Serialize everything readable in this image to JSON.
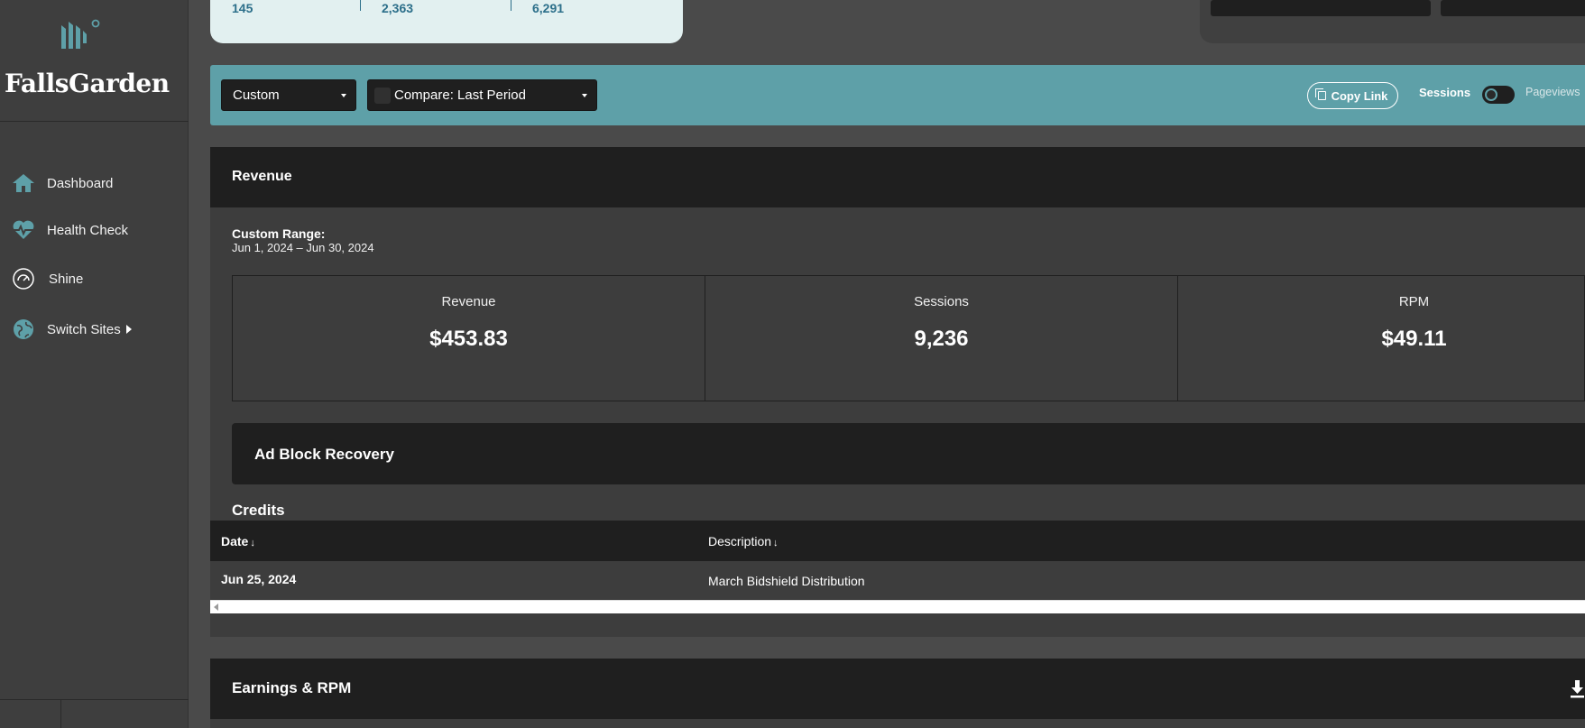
{
  "brand": {
    "name": "FallsGarden"
  },
  "sidebar": {
    "items": [
      {
        "label": "Dashboard",
        "icon": "home-icon"
      },
      {
        "label": "Health Check",
        "icon": "heartbeat-icon"
      },
      {
        "label": "Shine",
        "icon": "gauge-icon"
      },
      {
        "label": "Switch Sites",
        "icon": "globe-icon"
      }
    ]
  },
  "top_stats": {
    "values": [
      "145",
      "2,363",
      "6,291"
    ]
  },
  "filters": {
    "range_select": "Custom",
    "compare_select": "Compare: Last Period",
    "copy_link": "Copy Link",
    "toggle_left": "Sessions",
    "toggle_right": "Pageviews"
  },
  "revenue": {
    "title": "Revenue",
    "range_label": "Custom Range:",
    "range_value": "Jun 1, 2024 – Jun 30, 2024",
    "kpis": [
      {
        "label": "Revenue",
        "value": "$453.83"
      },
      {
        "label": "Sessions",
        "value": "9,236"
      },
      {
        "label": "RPM",
        "value": "$49.11"
      }
    ]
  },
  "ad_block": {
    "title": "Ad Block Recovery"
  },
  "credits": {
    "title": "Credits",
    "columns": [
      "Date",
      "Description"
    ],
    "rows": [
      {
        "date": "Jun 25, 2024",
        "description": "March Bidshield Distribution"
      }
    ]
  },
  "earnings": {
    "title": "Earnings & RPM"
  },
  "colors": {
    "accent": "#5ea0a8",
    "panel_dark": "#1f1f1f",
    "background": "#4a4a4a",
    "stat_card": "#e2f0f0"
  }
}
